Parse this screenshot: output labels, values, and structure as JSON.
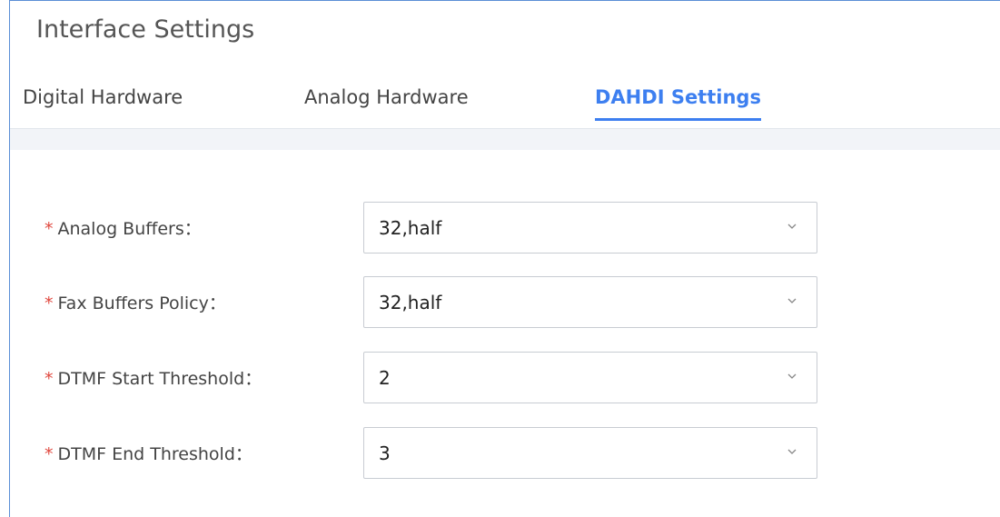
{
  "page": {
    "title": "Interface Settings"
  },
  "tabs": [
    {
      "label": "Digital Hardware",
      "active": false
    },
    {
      "label": "Analog Hardware",
      "active": false
    },
    {
      "label": "DAHDI Settings",
      "active": true
    }
  ],
  "form": {
    "required_mark": "*",
    "fields": [
      {
        "label": "Analog Buffers：",
        "value": "32,half"
      },
      {
        "label": "Fax Buffers Policy：",
        "value": "32,half"
      },
      {
        "label": "DTMF Start Threshold：",
        "value": "2"
      },
      {
        "label": "DTMF End Threshold：",
        "value": "3"
      }
    ]
  },
  "icons": {
    "select_arrow": "chevron-down-icon"
  },
  "colors": {
    "accent": "#3d7ff0",
    "required": "#e0483f",
    "frame_border": "#5b8fd6"
  }
}
